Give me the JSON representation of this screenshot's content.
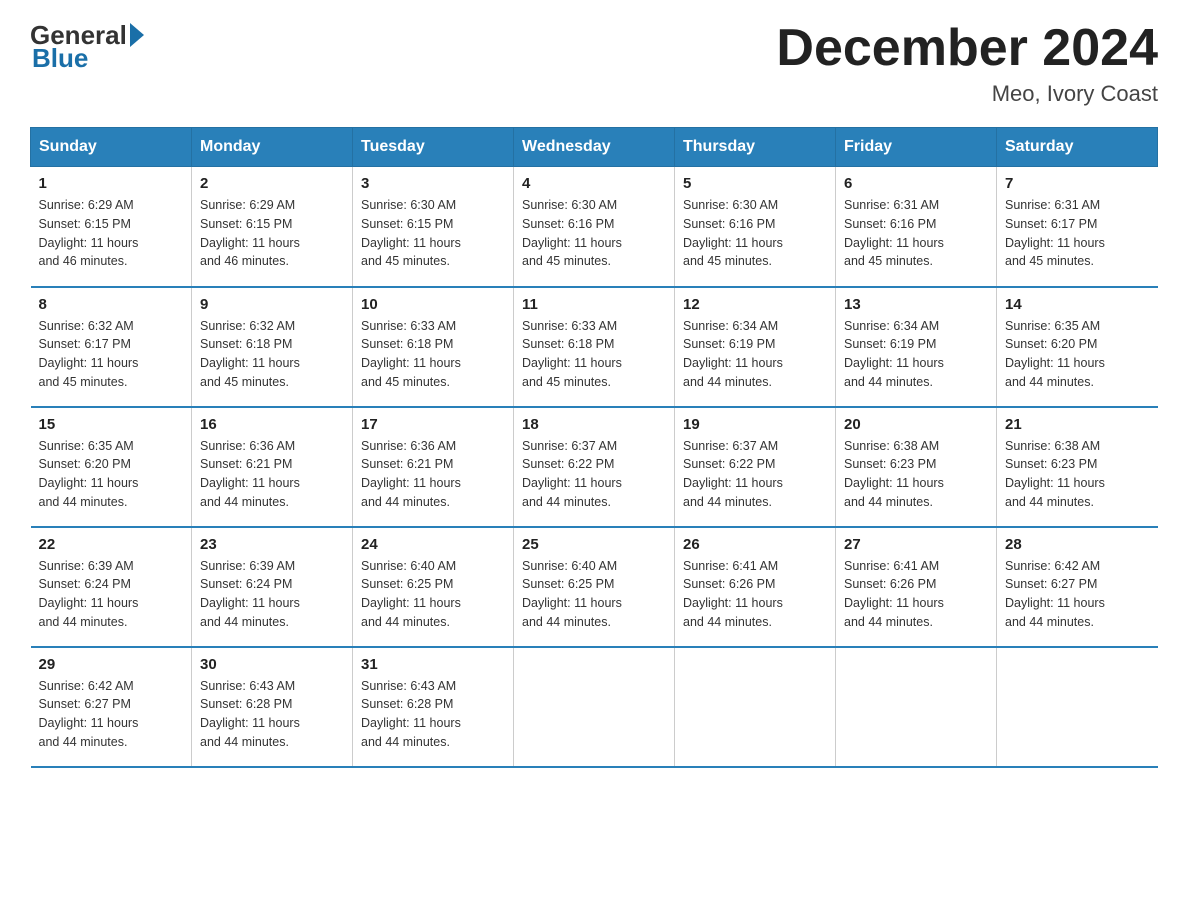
{
  "header": {
    "logo_general": "General",
    "logo_blue": "Blue",
    "month_title": "December 2024",
    "location": "Meo, Ivory Coast"
  },
  "days_of_week": [
    "Sunday",
    "Monday",
    "Tuesday",
    "Wednesday",
    "Thursday",
    "Friday",
    "Saturday"
  ],
  "weeks": [
    [
      {
        "day": "1",
        "info": "Sunrise: 6:29 AM\nSunset: 6:15 PM\nDaylight: 11 hours\nand 46 minutes."
      },
      {
        "day": "2",
        "info": "Sunrise: 6:29 AM\nSunset: 6:15 PM\nDaylight: 11 hours\nand 46 minutes."
      },
      {
        "day": "3",
        "info": "Sunrise: 6:30 AM\nSunset: 6:15 PM\nDaylight: 11 hours\nand 45 minutes."
      },
      {
        "day": "4",
        "info": "Sunrise: 6:30 AM\nSunset: 6:16 PM\nDaylight: 11 hours\nand 45 minutes."
      },
      {
        "day": "5",
        "info": "Sunrise: 6:30 AM\nSunset: 6:16 PM\nDaylight: 11 hours\nand 45 minutes."
      },
      {
        "day": "6",
        "info": "Sunrise: 6:31 AM\nSunset: 6:16 PM\nDaylight: 11 hours\nand 45 minutes."
      },
      {
        "day": "7",
        "info": "Sunrise: 6:31 AM\nSunset: 6:17 PM\nDaylight: 11 hours\nand 45 minutes."
      }
    ],
    [
      {
        "day": "8",
        "info": "Sunrise: 6:32 AM\nSunset: 6:17 PM\nDaylight: 11 hours\nand 45 minutes."
      },
      {
        "day": "9",
        "info": "Sunrise: 6:32 AM\nSunset: 6:18 PM\nDaylight: 11 hours\nand 45 minutes."
      },
      {
        "day": "10",
        "info": "Sunrise: 6:33 AM\nSunset: 6:18 PM\nDaylight: 11 hours\nand 45 minutes."
      },
      {
        "day": "11",
        "info": "Sunrise: 6:33 AM\nSunset: 6:18 PM\nDaylight: 11 hours\nand 45 minutes."
      },
      {
        "day": "12",
        "info": "Sunrise: 6:34 AM\nSunset: 6:19 PM\nDaylight: 11 hours\nand 44 minutes."
      },
      {
        "day": "13",
        "info": "Sunrise: 6:34 AM\nSunset: 6:19 PM\nDaylight: 11 hours\nand 44 minutes."
      },
      {
        "day": "14",
        "info": "Sunrise: 6:35 AM\nSunset: 6:20 PM\nDaylight: 11 hours\nand 44 minutes."
      }
    ],
    [
      {
        "day": "15",
        "info": "Sunrise: 6:35 AM\nSunset: 6:20 PM\nDaylight: 11 hours\nand 44 minutes."
      },
      {
        "day": "16",
        "info": "Sunrise: 6:36 AM\nSunset: 6:21 PM\nDaylight: 11 hours\nand 44 minutes."
      },
      {
        "day": "17",
        "info": "Sunrise: 6:36 AM\nSunset: 6:21 PM\nDaylight: 11 hours\nand 44 minutes."
      },
      {
        "day": "18",
        "info": "Sunrise: 6:37 AM\nSunset: 6:22 PM\nDaylight: 11 hours\nand 44 minutes."
      },
      {
        "day": "19",
        "info": "Sunrise: 6:37 AM\nSunset: 6:22 PM\nDaylight: 11 hours\nand 44 minutes."
      },
      {
        "day": "20",
        "info": "Sunrise: 6:38 AM\nSunset: 6:23 PM\nDaylight: 11 hours\nand 44 minutes."
      },
      {
        "day": "21",
        "info": "Sunrise: 6:38 AM\nSunset: 6:23 PM\nDaylight: 11 hours\nand 44 minutes."
      }
    ],
    [
      {
        "day": "22",
        "info": "Sunrise: 6:39 AM\nSunset: 6:24 PM\nDaylight: 11 hours\nand 44 minutes."
      },
      {
        "day": "23",
        "info": "Sunrise: 6:39 AM\nSunset: 6:24 PM\nDaylight: 11 hours\nand 44 minutes."
      },
      {
        "day": "24",
        "info": "Sunrise: 6:40 AM\nSunset: 6:25 PM\nDaylight: 11 hours\nand 44 minutes."
      },
      {
        "day": "25",
        "info": "Sunrise: 6:40 AM\nSunset: 6:25 PM\nDaylight: 11 hours\nand 44 minutes."
      },
      {
        "day": "26",
        "info": "Sunrise: 6:41 AM\nSunset: 6:26 PM\nDaylight: 11 hours\nand 44 minutes."
      },
      {
        "day": "27",
        "info": "Sunrise: 6:41 AM\nSunset: 6:26 PM\nDaylight: 11 hours\nand 44 minutes."
      },
      {
        "day": "28",
        "info": "Sunrise: 6:42 AM\nSunset: 6:27 PM\nDaylight: 11 hours\nand 44 minutes."
      }
    ],
    [
      {
        "day": "29",
        "info": "Sunrise: 6:42 AM\nSunset: 6:27 PM\nDaylight: 11 hours\nand 44 minutes."
      },
      {
        "day": "30",
        "info": "Sunrise: 6:43 AM\nSunset: 6:28 PM\nDaylight: 11 hours\nand 44 minutes."
      },
      {
        "day": "31",
        "info": "Sunrise: 6:43 AM\nSunset: 6:28 PM\nDaylight: 11 hours\nand 44 minutes."
      },
      {
        "day": "",
        "info": ""
      },
      {
        "day": "",
        "info": ""
      },
      {
        "day": "",
        "info": ""
      },
      {
        "day": "",
        "info": ""
      }
    ]
  ]
}
